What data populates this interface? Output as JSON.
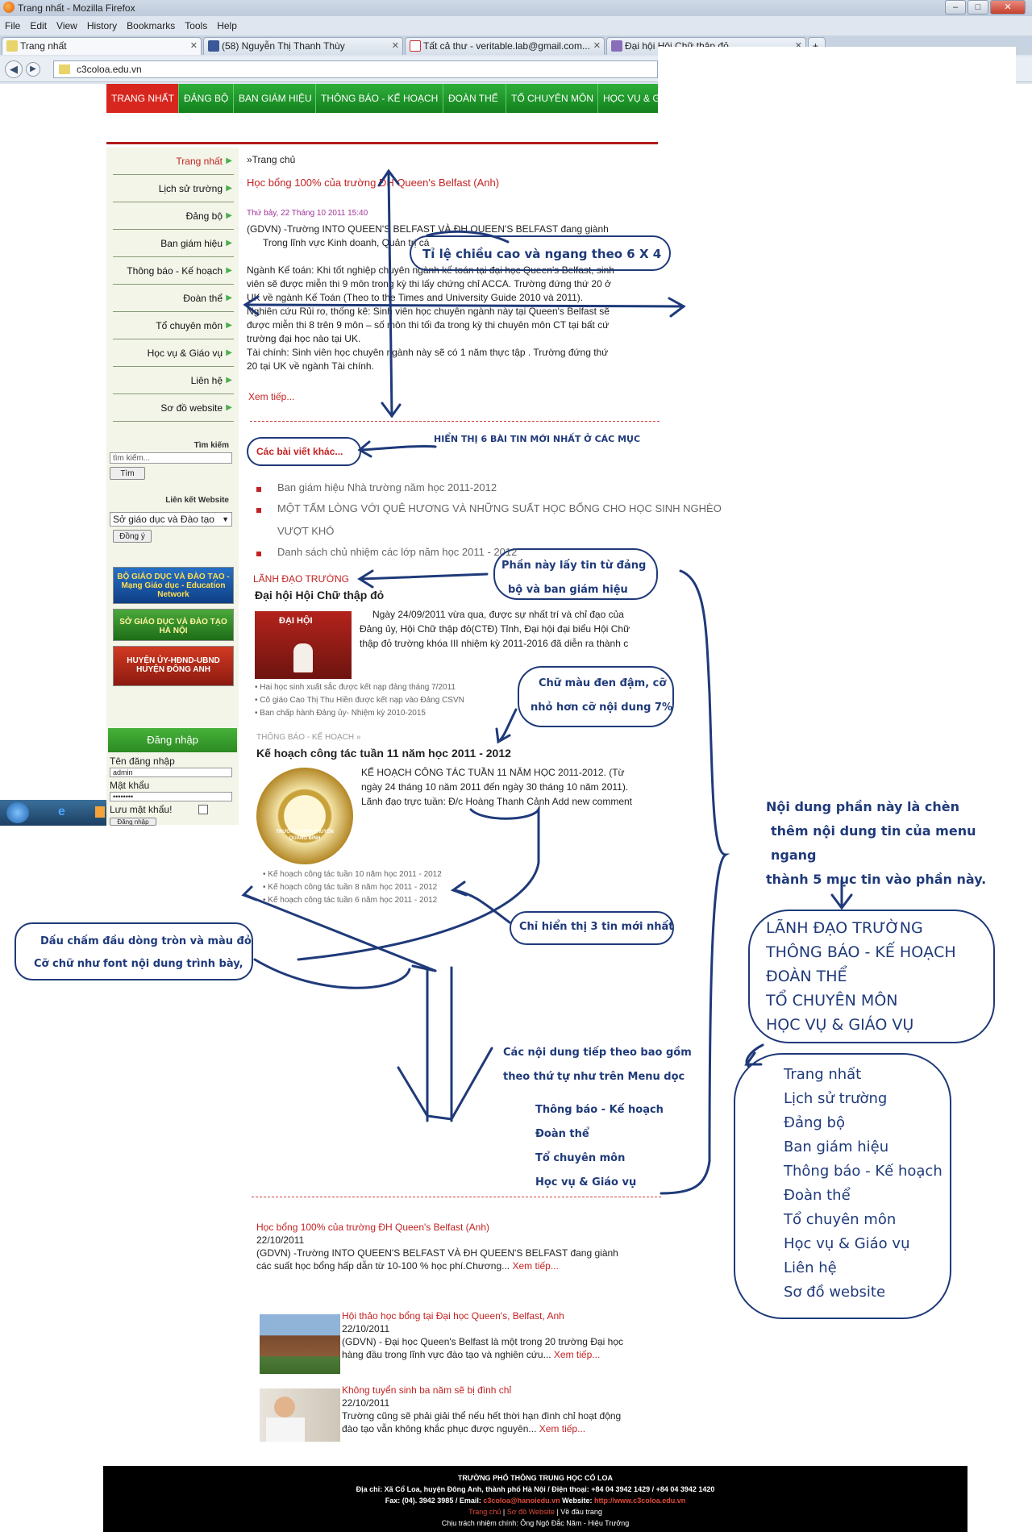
{
  "browser": {
    "window_title": "Trang nhất - Mozilla Firefox",
    "menu": [
      "File",
      "Edit",
      "View",
      "History",
      "Bookmarks",
      "Tools",
      "Help"
    ],
    "tabs": [
      {
        "label": "Trang nhất",
        "active": true
      },
      {
        "label": "(58) Nguyễn Thị Thanh Thùy"
      },
      {
        "label": "Tất cả thư - veritable.lab@gmail.com..."
      },
      {
        "label": "Đại hội Hội Chữ thập đỏ"
      }
    ],
    "new_tab": "+",
    "url": "c3coloa.edu.vn"
  },
  "site": {
    "top_nav": [
      "TRANG NHẤT",
      "ĐẢNG BỘ",
      "BAN GIÁM HIỆU",
      "THÔNG BÁO - KẾ HOẠCH",
      "ĐOÀN THỂ",
      "TỔ CHUYÊN MÔN",
      "HỌC VỤ & G"
    ],
    "sidebar": {
      "items": [
        "Trang nhất",
        "Lịch sử trường",
        "Đảng bộ",
        "Ban giám hiệu",
        "Thông báo - Kế hoạch",
        "Đoàn thể",
        "Tổ chuyên môn",
        "Học vụ & Giáo vụ",
        "Liên hệ",
        "Sơ đồ website"
      ],
      "search_label": "Tìm kiếm",
      "search_placeholder": "tìm kiếm...",
      "search_button": "Tìm",
      "links_label": "Liên kết Website",
      "links_select": "Sở giáo dục và Đào tạo",
      "links_button": "Đồng ý",
      "banners": [
        "BỘ GIÁO DỤC VÀ ĐÀO TẠO - Mạng Giáo dục - Education Network",
        "SỞ GIÁO DỤC VÀ ĐÀO TẠO HÀ NỘI",
        "HUYỆN ỦY-HĐND-UBND HUYỆN ĐÔNG ANH"
      ],
      "login_title": "Đăng nhập",
      "username_label": "Tên đăng nhập",
      "username_value": "admin",
      "password_label": "Mật khẩu",
      "password_value": "••••••••",
      "remember_label": "Lưu mật khẩu!",
      "login_button": "Đăng nhập"
    },
    "breadcrumb": "»Trang chủ",
    "feature": {
      "title": "Học bổng 100% của trường ĐH Queen's Belfast (Anh)",
      "date": "Thứ bảy, 22 Tháng 10 2011 15:40",
      "lines": [
        "(GDVN) -Trường INTO QUEEN'S BELFAST VÀ ĐH QUEEN'S BELFAST đang giành",
        "Trong lĩnh vực Kinh doanh, Quản trị cá",
        "",
        "Ngành Kế toán: Khi tốt nghiệp chuyên ngành kế toán tại đại học Queen's Belfast, sinh",
        "viên sẽ được miễn thi 9 môn trong kỳ thi lấy chứng chỉ ACCA. Trường đứng thứ 20 ở",
        "UK về ngành Kế Toán (Theo to the Times and University Guide 2010 và 2011).",
        "Nghiên cứu Rủi ro, thống kê: Sinh viên học chuyên ngành này tại Queen's Belfast sẽ",
        "được miễn thi 8 trên 9 môn – số môn thi tối đa trong kỳ thi chuyên môn CT tại bất cứ",
        "trường đại học nào tại UK.",
        "Tài chính: Sinh viên học chuyên ngành này sẽ có 1 năm thực tập . Trường đứng thứ",
        "20 tại UK về ngành Tài chính."
      ],
      "more": "Xem tiếp..."
    },
    "other_posts": {
      "title": "Các bài viết khác...",
      "items": [
        "Ban giám hiệu Nhà trường năm học 2011-2012",
        "MỘT TẤM LÒNG VỚI QUÊ HƯƠNG VÀ NHỮNG SUẤT HỌC BỔNG CHO HỌC SINH NGHÈO",
        "VƯỢT KHÓ",
        "Danh sách chủ nhiệm các lớp năm học 2011 - 2012"
      ]
    },
    "leadership": {
      "section": "LÃNH ĐẠO TRƯỜNG",
      "title": "Đại hội Hội Chữ thập đỏ",
      "thumb_caption": "ĐẠI HỘI",
      "text": [
        "Ngày 24/09/2011 vừa qua, được sự nhất trí và chỉ đạo của",
        "Đảng ủy, Hội Chữ thập đỏ(CTĐ) Tỉnh, Đại hội đại biểu Hội Chữ",
        "thập đỏ trường khóa III nhiệm kỳ 2011-2016 đã diễn ra thành c"
      ],
      "links": [
        "Hai học sinh xuất sắc được kết nạp đảng tháng 7/2011",
        "Cô giáo Cao Thị Thu Hiền được kết nạp vào Đảng CSVN",
        "Ban chấp hành Đảng ủy- Nhiệm kỳ 2010-2015"
      ]
    },
    "plans": {
      "section": "THÔNG BÁO - KẾ HOẠCH »",
      "title": "Kế hoạch công tác tuần 11 năm học 2011 - 2012",
      "seal_text": "TRƯỜNG THPT CHUYÊN QUANG BÌNH",
      "text": [
        "KẾ HOẠCH  CÔNG TÁC TUẦN 11 NĂM HỌC 2011-2012. (Từ",
        "ngày 24 tháng 10  năm 2011 đến ngày 30 tháng 10 năm 2011).",
        "Lãnh đạo trực tuần: Đ/c Hoàng Thanh Cảnh Add new comment"
      ],
      "links": [
        "Kế hoạch công tác tuần 10 năm học 2011 - 2012",
        "Kế hoạch công tác tuần 8 năm học 2011 - 2012",
        "Kế hoạch công tác tuần 6 năm học 2011 - 2012"
      ]
    },
    "news": [
      {
        "title": "Học bổng 100% của trường ĐH Queen's Belfast (Anh)",
        "date": "22/10/2011",
        "text1": "(GDVN) -Trường INTO QUEEN'S BELFAST VÀ ĐH QUEEN'S BELFAST đang giành",
        "text2": "các suất học bổng hấp dẫn từ 10-100 % học phí.Chương...",
        "more": "Xem tiếp..."
      },
      {
        "title": "Hội thảo học bổng tại Đại học Queen's, Belfast, Anh",
        "date": "22/10/2011",
        "text1": "(GDVN) - Đại học Queen's Belfast là một trong 20 trường Đại học",
        "text2": "hàng đầu trong lĩnh vực đào tạo và nghiên cứu...",
        "more": "Xem tiếp..."
      },
      {
        "title": "Không tuyển sinh ba năm sẽ bị đình chỉ",
        "date": "22/10/2011",
        "text1": "Trường cũng sẽ phải giải thể nếu hết thời hạn đình chỉ hoạt động",
        "text2": "đào tạo vẫn không khắc phục được nguyên...",
        "more": "Xem tiếp..."
      }
    ],
    "footer": {
      "school": "TRƯỜNG PHỔ THÔNG TRUNG HỌC CỔ LOA",
      "address": "Địa chỉ: Xã Cổ Loa, huyện Đông Anh, thành phố Hà Nội  / Điện thoại: +84 04 3942 1429 / +84 04 3942 1420",
      "fax_prefix": "Fax: (04). 3942 3985 / Email:",
      "email": "c3coloa@hanoiedu.vn",
      "website_label": "Website:",
      "website": "http://www.c3coloa.edu.vn",
      "links": [
        "Trang chủ",
        "Sơ đồ Website"
      ],
      "top_link": "Về đầu trang",
      "responsible": "Chịu trách nhiệm chính: Ông Ngô Đắc Năm - Hiệu Trưởng"
    }
  },
  "annotations": {
    "ratio": "Tỉ lệ chiều cao và ngang theo 6 X 4",
    "show6": "HIỂN THỊ 6 BÀI TIN MỚI NHẤT Ở CÁC MỤC",
    "party_note_1": "Phần này lấy tin từ đảng",
    "party_note_2": "bộ và ban giám hiệu",
    "bold_note_1": "Chữ màu đen đậm, cỡ",
    "bold_note_2": "nhỏ hơn cỡ nội dung 7%",
    "bullet_note_1": "Dấu chấm đầu dòng tròn và màu đỏ",
    "bullet_note_2": "Cỡ chữ như font nội dung trình bày,",
    "three_note": "Chỉ hiển thị 3 tin mới nhất",
    "following_1": "Các nội dung tiếp theo bao gồm",
    "following_2": "theo thứ tự như trên Menu dọc",
    "following_list": [
      "Thông báo - Kế hoạch",
      "Đoàn thể",
      "Tổ chuyên môn",
      "Học vụ & Giáo vụ"
    ],
    "insert_note": [
      "Nội dung phần này là chèn",
      "thêm nội dung tin của menu ngang",
      "thành 5 mục tin vào phần này."
    ],
    "five_list": [
      "LÃNH ĐẠO TRƯỜNG",
      "THÔNG BÁO - KẾ HOẠCH",
      "ĐOÀN THỂ",
      "TỔ CHUYÊN MÔN",
      "HỌC VỤ & GIÁO VỤ"
    ],
    "menu_list": [
      "Trang nhất",
      "Lịch sử trường",
      "Đảng bộ",
      "Ban giám hiệu",
      "Thông báo - Kế hoạch",
      "Đoàn thể",
      "Tổ chuyên môn",
      "Học vụ & Giáo vụ",
      "Liên hệ",
      "Sơ đồ website"
    ]
  }
}
